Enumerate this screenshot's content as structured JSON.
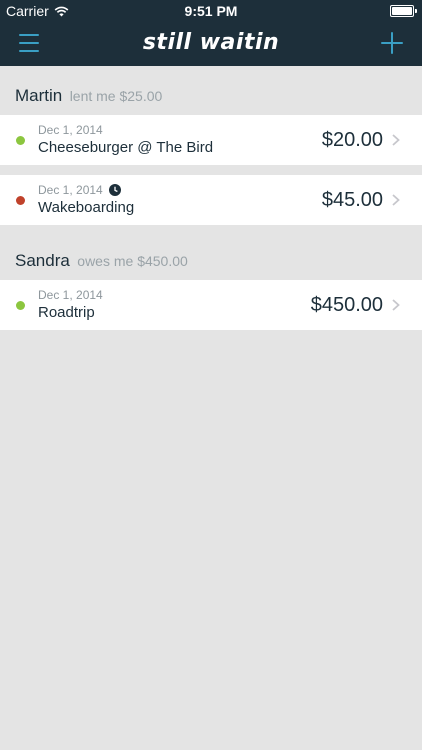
{
  "status_bar": {
    "carrier": "Carrier",
    "time": "9:51 PM"
  },
  "nav": {
    "title": "still waitin",
    "menu_icon": "hamburger-menu-icon",
    "add_icon": "plus-icon"
  },
  "colors": {
    "nav_background": "#1d2f3a",
    "accent": "#3a9fc4",
    "status_green": "#8cc63f",
    "status_red": "#c0422b"
  },
  "groups": [
    {
      "name": "Martin",
      "summary": "lent me $25.00",
      "items": [
        {
          "date": "Dec 1, 2014",
          "title": "Cheeseburger @ The Bird",
          "amount": "$20.00",
          "status_color": "#8cc63f",
          "has_clock": false
        },
        {
          "date": "Dec 1, 2014",
          "title": "Wakeboarding",
          "amount": "$45.00",
          "status_color": "#c0422b",
          "has_clock": true
        }
      ]
    },
    {
      "name": "Sandra",
      "summary": "owes me $450.00",
      "items": [
        {
          "date": "Dec 1, 2014",
          "title": "Roadtrip",
          "amount": "$450.00",
          "status_color": "#8cc63f",
          "has_clock": false
        }
      ]
    }
  ]
}
